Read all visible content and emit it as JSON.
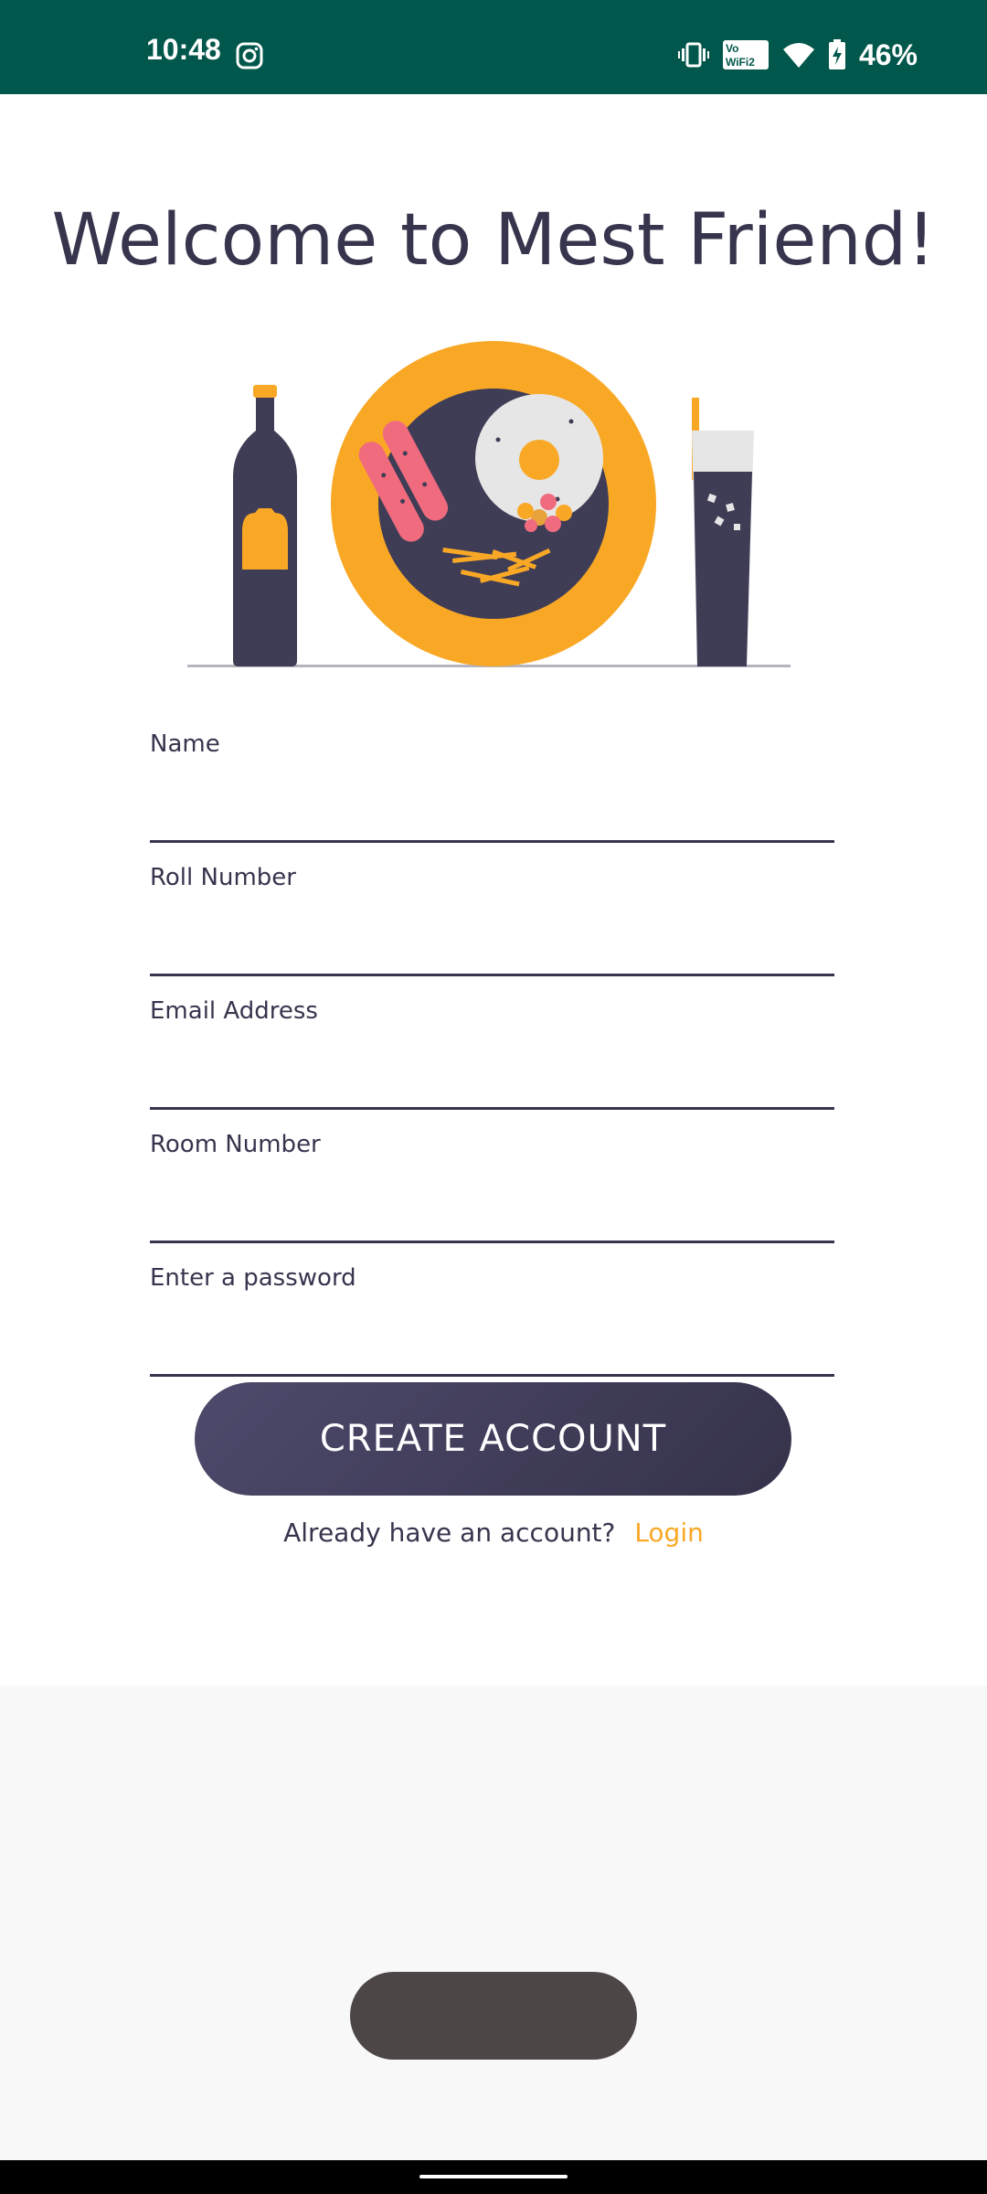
{
  "status_bar": {
    "time": "10:48",
    "battery_percent": "46%",
    "icons": [
      "instagram-icon",
      "vibrate-icon",
      "vowifi-icon",
      "wifi-icon",
      "battery-charging-icon"
    ],
    "vowifi_text": "Vo WiFi 2",
    "background_color": "#01574b"
  },
  "page": {
    "title": "Welcome to Mest Friend!",
    "illustration": "food-plate-illustration"
  },
  "form": {
    "fields": [
      {
        "label": "Name",
        "value": ""
      },
      {
        "label": "Roll Number",
        "value": ""
      },
      {
        "label": "Email Address",
        "value": ""
      },
      {
        "label": "Room Number",
        "value": ""
      },
      {
        "label": "Enter a password",
        "value": ""
      }
    ],
    "submit_label": "CREATE ACCOUNT",
    "login_prompt": "Already have an account?",
    "login_link": "Login"
  },
  "colors": {
    "text_primary": "#37354d",
    "accent": "#f9a826",
    "button": "#46425f"
  }
}
